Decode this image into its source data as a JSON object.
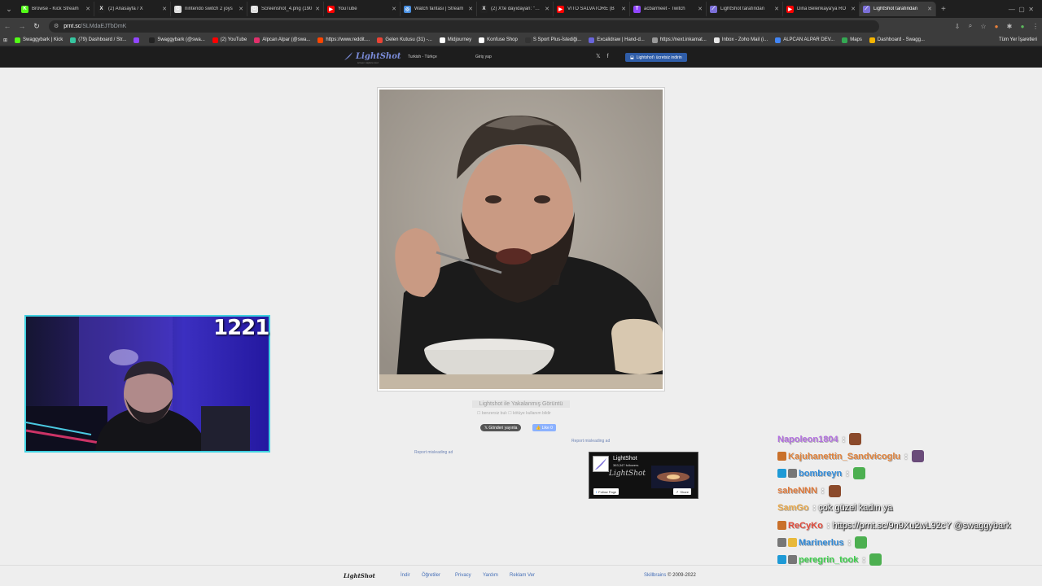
{
  "browser": {
    "tabs": [
      {
        "title": "Browse - Kick Stream",
        "color": "#53fc18",
        "glyph": "K"
      },
      {
        "title": "(2) Anasayfa / X",
        "color": "#222222",
        "glyph": "X"
      },
      {
        "title": "nintendo switch 2 joys",
        "color": "#dddddd",
        "glyph": "G"
      },
      {
        "title": "Screenshot_4.png (190",
        "color": "#dddddd",
        "glyph": "G"
      },
      {
        "title": "YouTube",
        "color": "#ff0000",
        "glyph": "▶"
      },
      {
        "title": "Watch fantasi | Stream",
        "color": "#4a90e2",
        "glyph": "◎"
      },
      {
        "title": "(2) X'te dayıdayan: \"http",
        "color": "#222222",
        "glyph": "X"
      },
      {
        "title": "VITO SALVATORE (B",
        "color": "#ff0000",
        "glyph": "▶"
      },
      {
        "title": "acbarmeet - Twitch",
        "color": "#9146ff",
        "glyph": "T"
      },
      {
        "title": "LightShot tarafından",
        "color": "#7b6fd8",
        "glyph": "⟋"
      },
      {
        "title": "Dina Belenkaya'ya RO",
        "color": "#ff0000",
        "glyph": "▶"
      },
      {
        "title": "LightShot tarafından",
        "color": "#7b6fd8",
        "glyph": "⟋"
      }
    ],
    "active_tab": 11,
    "url_domain": "prnt.sc",
    "url_path": "/SLMdaEJTbDmK",
    "bookmarks": [
      {
        "label": "Swaggybark | Kick",
        "color": "#53fc18"
      },
      {
        "label": "(79) Dashboard / Str...",
        "color": "#36c5a0"
      },
      {
        "label": "",
        "color": "#9146ff"
      },
      {
        "label": "Swaggybark (@swa...",
        "color": "#222222"
      },
      {
        "label": "(2) YouTube",
        "color": "#ff0000"
      },
      {
        "label": "Alpcan Alpar (@swa...",
        "color": "#e1306c"
      },
      {
        "label": "https://www.reddit....",
        "color": "#ff4500"
      },
      {
        "label": "Gelen Kutusu (31) -...",
        "color": "#ea4335"
      },
      {
        "label": "Midjourney",
        "color": "#ffffff"
      },
      {
        "label": "Konfuse Shop",
        "color": "#ffffff"
      },
      {
        "label": "S Sport Plus-İstediği...",
        "color": "#333333"
      },
      {
        "label": "Excalidraw | Hand-d...",
        "color": "#6965db"
      },
      {
        "label": "https://next.inkamat...",
        "color": "#999999"
      },
      {
        "label": "Inbox - Zoho Mail (i...",
        "color": "#e8e8e8"
      },
      {
        "label": "ALPCAN ALPAR DEV...",
        "color": "#4285f4"
      },
      {
        "label": "Maps",
        "color": "#34a853"
      },
      {
        "label": "Dashboard - Swagg...",
        "color": "#f4b400"
      }
    ],
    "all_bookmarks": "Tüm Yer İşaretleri"
  },
  "lightshot": {
    "logo": "LightShot",
    "logo_sub": "screen capture tool",
    "lang": "Turkish - Türkçe",
    "login": "Giriş yap",
    "social": "𝕏 f",
    "download": "Lightshot'ı ücretsiz indirin",
    "caption": "Lightshot ile Yakalanmış Görüntü",
    "tags": "☐ benzersiz bulı  ☐ kötüye kullanım bildir",
    "tweet": "𝕏 Gönderi yayınla",
    "like": "👍 Like 0",
    "report_left": "Report misleading ad",
    "report_right": "Report misleading ad",
    "fb": {
      "name": "LightShot",
      "followers": "363,347 followers",
      "brand": "LightShot",
      "follow": "Follow Page",
      "share": "Share"
    },
    "footer": {
      "logo": "LightShot",
      "links": [
        "İndir",
        "Öğretiler",
        "Privacy",
        "Yardım",
        "Reklam Ver"
      ],
      "brand": "Skillbrains",
      "copy": "© 2009-2022"
    }
  },
  "overlay": {
    "counter": "1221",
    "chat": [
      {
        "user": "Napoleon1804",
        "user_color": "#b26ee0",
        "badges": [],
        "sep": ":",
        "msg": "",
        "emote": "#8b4a2b"
      },
      {
        "user": "Kajuhanettin_Sandvicoglu",
        "user_color": "#e0823b",
        "badges": [
          "#c9702a"
        ],
        "sep": ":",
        "msg": "",
        "emote": "#6a4b7a"
      },
      {
        "user": "bombreyn",
        "user_color": "#2f8ad8",
        "badges": [
          "#1e9ad6",
          "#777777"
        ],
        "sep": ":",
        "msg": "",
        "emote": "#4caf50"
      },
      {
        "user": "saheNNN",
        "user_color": "#e07a3b",
        "badges": [],
        "sep": ":",
        "msg": "",
        "emote": "#8b4a2b"
      },
      {
        "user": "SamGo",
        "user_color": "#e8a84a",
        "badges": [],
        "sep": ":",
        "msg": "çok güzel kadın ya",
        "emote": ""
      },
      {
        "user": "ReCyKo",
        "user_color": "#e04a3b",
        "badges": [
          "#c9702a"
        ],
        "sep": ":",
        "msg": "https://prnt.sc/9n9Xu2wL92cY @swaggybark",
        "emote": ""
      },
      {
        "user": "Marinerlus",
        "user_color": "#2f8ad8",
        "badges": [
          "#777777",
          "#e8b93b"
        ],
        "sep": ":",
        "msg": "",
        "emote": "#4caf50"
      },
      {
        "user": "peregrin_took",
        "user_color": "#3bd04a",
        "badges": [
          "#1e9ad6",
          "#777777"
        ],
        "sep": ":",
        "msg": "",
        "emote": "#4caf50"
      }
    ]
  }
}
